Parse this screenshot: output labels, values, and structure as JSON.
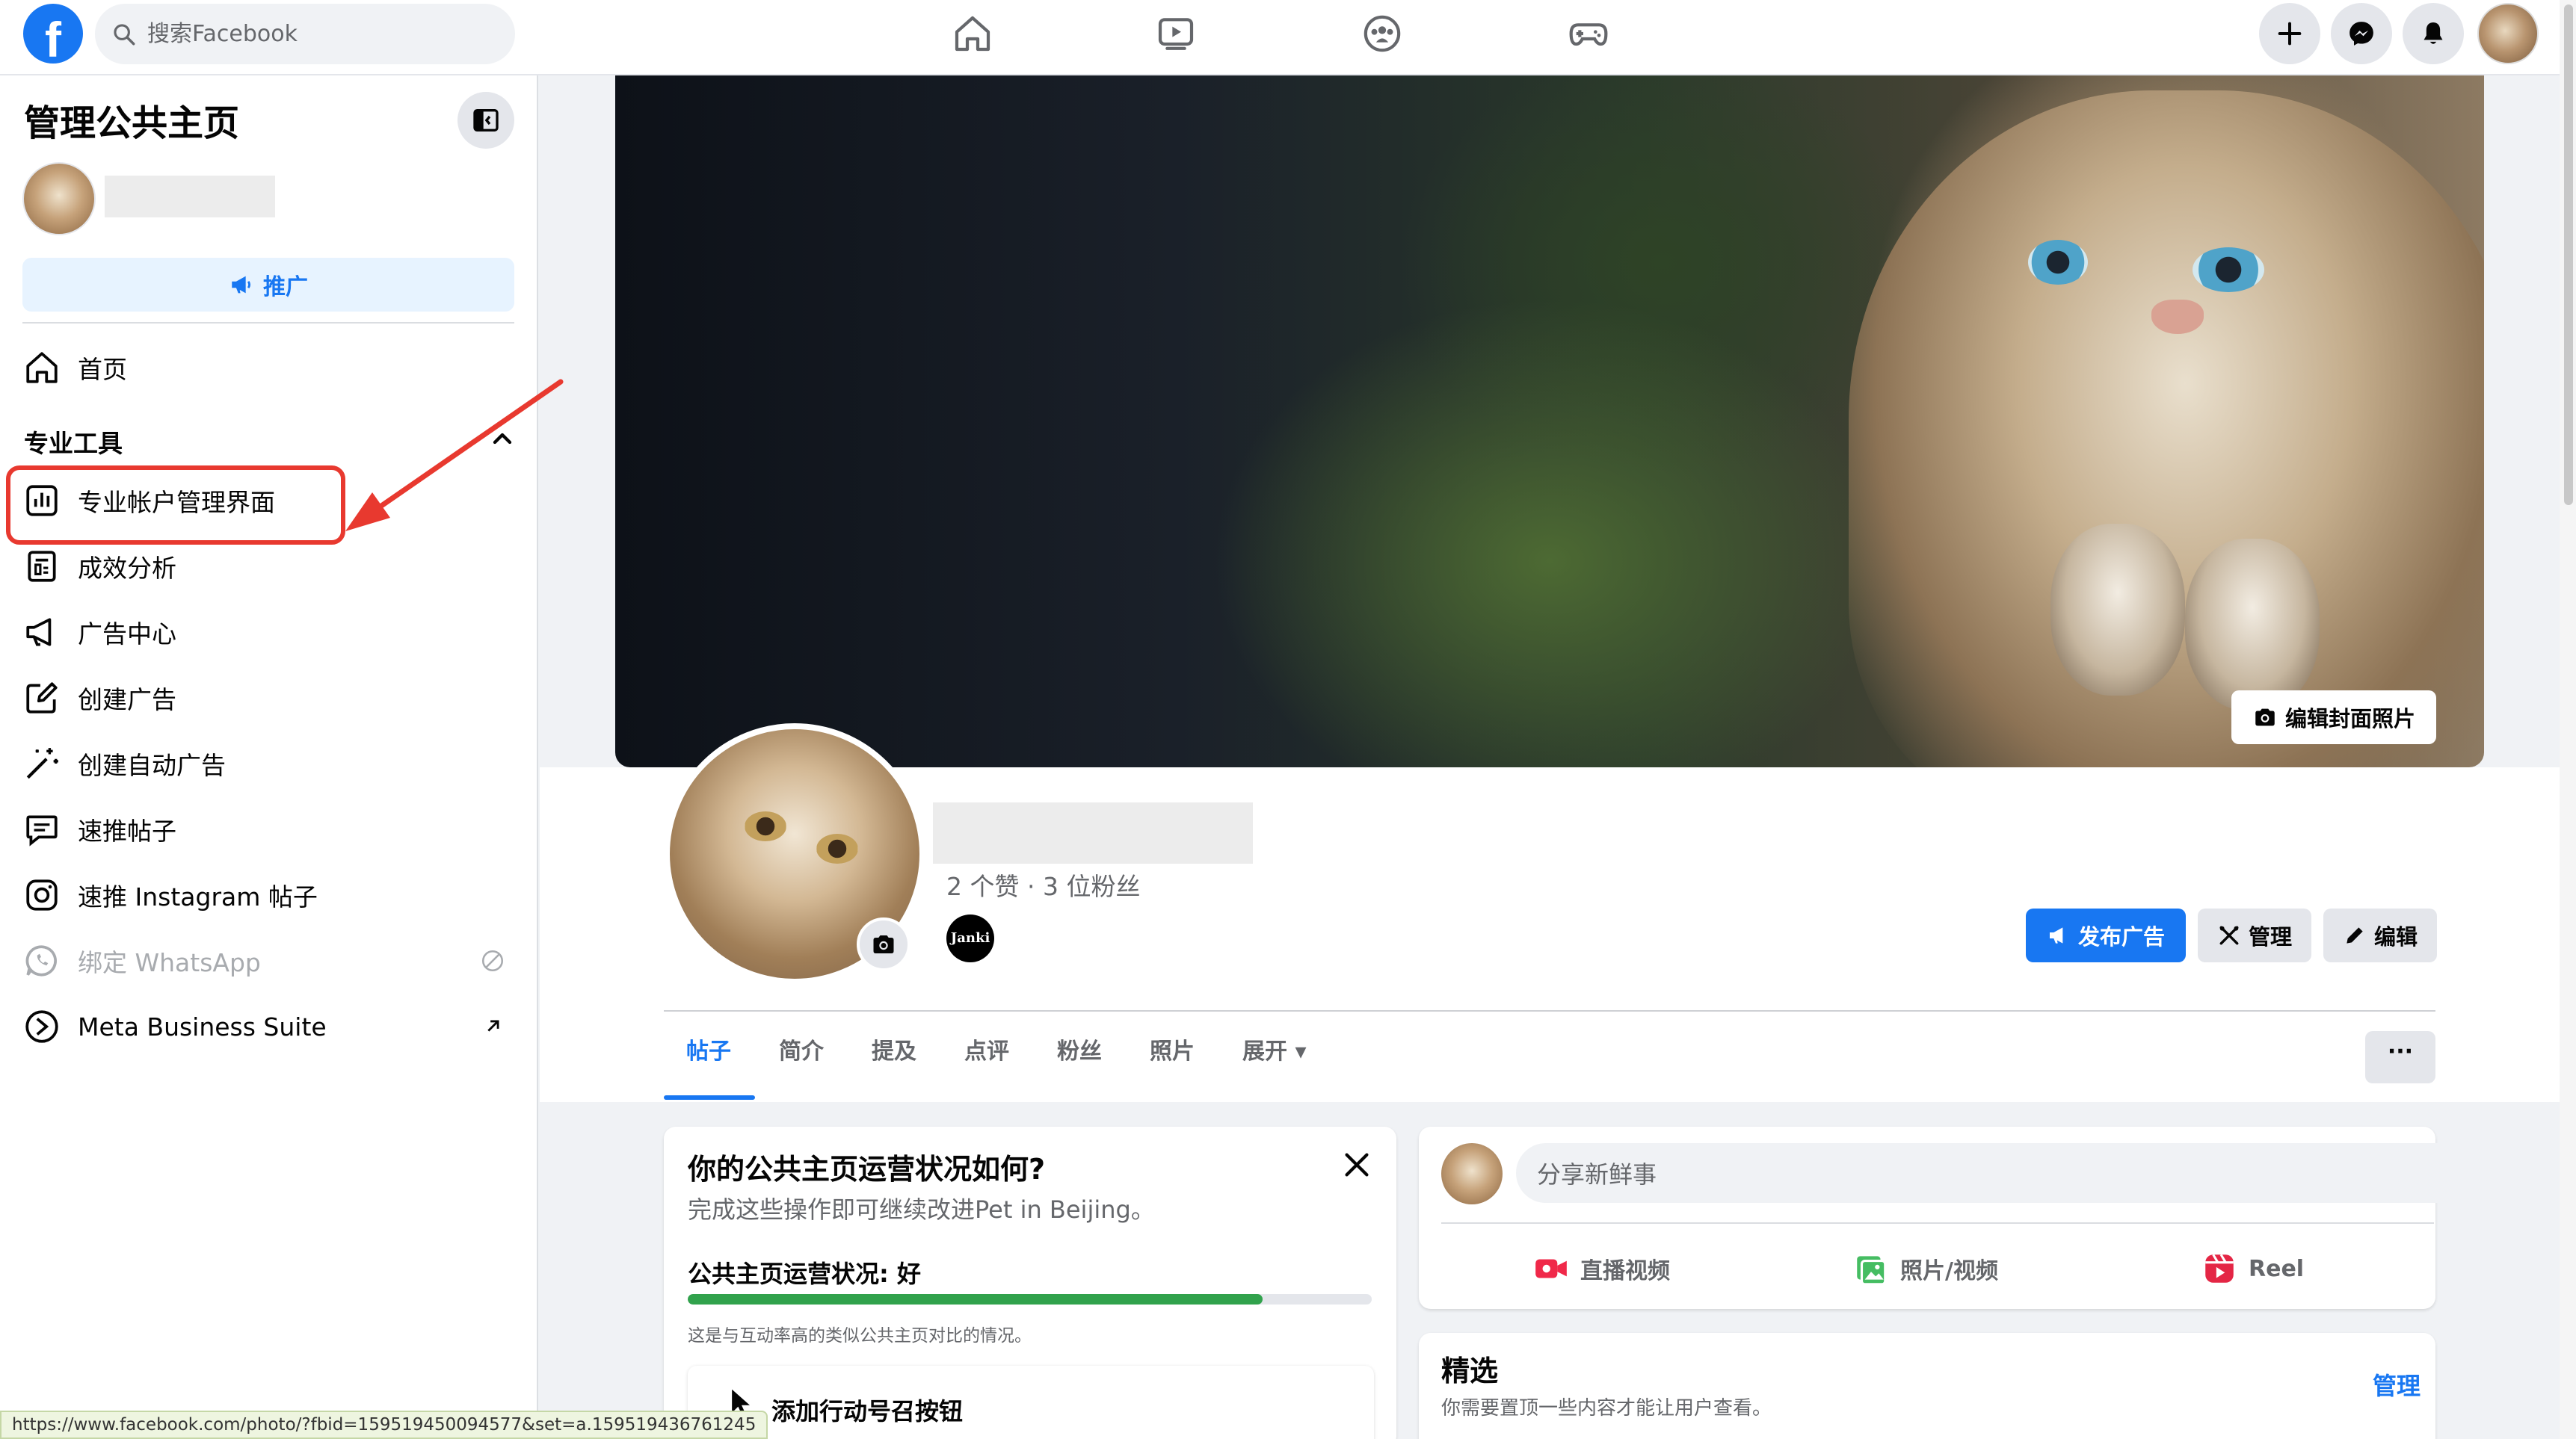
{
  "topbar": {
    "logo_letter": "f",
    "search_placeholder": "搜索Facebook",
    "nav_icons": [
      "home-icon",
      "watch-icon",
      "groups-icon",
      "gaming-icon"
    ],
    "right_icons": [
      "plus-icon",
      "messenger-icon",
      "bell-icon"
    ]
  },
  "sidebar": {
    "title": "管理公共主页",
    "promote_label": "推广",
    "home_label": "首页",
    "section_title": "专业工具",
    "items": [
      {
        "label": "专业帐户管理界面",
        "icon": "dashboard-icon"
      },
      {
        "label": "成效分析",
        "icon": "insights-icon"
      },
      {
        "label": "广告中心",
        "icon": "megaphone-icon"
      },
      {
        "label": "创建广告",
        "icon": "edit-square-icon"
      },
      {
        "label": "创建自动广告",
        "icon": "magic-wand-icon"
      },
      {
        "label": "速推帖子",
        "icon": "boost-post-icon"
      },
      {
        "label": "速推 Instagram 帖子",
        "icon": "instagram-icon"
      },
      {
        "label": "绑定 WhatsApp",
        "icon": "whatsapp-icon"
      },
      {
        "label": "Meta Business Suite",
        "icon": "meta-business-icon"
      }
    ]
  },
  "cover": {
    "edit_label": "编辑封面照片"
  },
  "profile": {
    "stats": "2 个赞 · 3 位粉丝",
    "follower_badge": "Janki",
    "buttons": {
      "advertise": "发布广告",
      "manage": "管理",
      "edit": "编辑"
    }
  },
  "tabs": [
    "帖子",
    "简介",
    "提及",
    "点评",
    "粉丝",
    "照片",
    "展开 ▾"
  ],
  "more_label": "···",
  "health_card": {
    "title": "你的公共主页运营状况如何?",
    "subtitle": "完成这些操作即可继续改进Pet in Beijing。",
    "status": "公共主页运营状况:  好",
    "progress": 0.84,
    "note": "这是与互动率高的类似公共主页对比的情况。",
    "task": "添加行动号召按钮"
  },
  "composer": {
    "placeholder": "分享新鲜事",
    "actions": [
      "直播视频",
      "照片/视频",
      "Reel"
    ]
  },
  "featured": {
    "title": "精选",
    "subtitle": "你需要置顶一些内容才能让用户查看。",
    "manage": "管理"
  },
  "status_url": "https://www.facebook.com/photo/?fbid=159519450094577&set=a.159519436761245",
  "colors": {
    "brand": "#1877f2",
    "highlight": "#e8392f",
    "progress": "#31a24c"
  }
}
